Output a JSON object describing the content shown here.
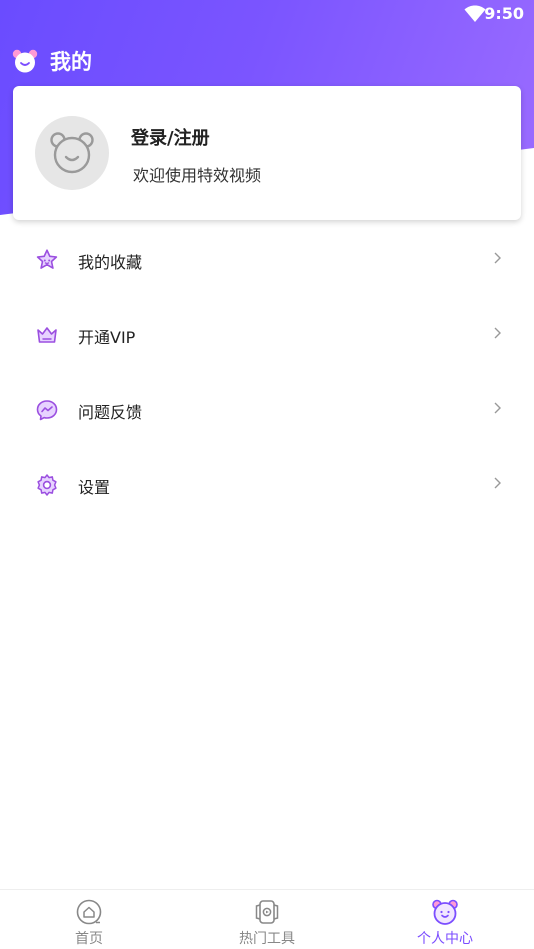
{
  "status_bar": {
    "time": "9:50"
  },
  "header": {
    "title": "我的"
  },
  "profile": {
    "login_label": "登录/注册",
    "welcome_text": "欢迎使用特效视频"
  },
  "menu": {
    "items": [
      {
        "label": "我的收藏",
        "icon": "star-icon"
      },
      {
        "label": "开通VIP",
        "icon": "crown-icon"
      },
      {
        "label": "问题反馈",
        "icon": "message-icon"
      },
      {
        "label": "设置",
        "icon": "gear-icon"
      }
    ]
  },
  "tabbar": {
    "tabs": [
      {
        "label": "首页",
        "icon": "home-icon",
        "active": false
      },
      {
        "label": "热门工具",
        "icon": "tools-icon",
        "active": false
      },
      {
        "label": "个人中心",
        "icon": "bear-icon",
        "active": true
      }
    ]
  },
  "colors": {
    "accent": "#7b4dff",
    "header_start": "#6a4cff",
    "header_end": "#9b6cff"
  }
}
